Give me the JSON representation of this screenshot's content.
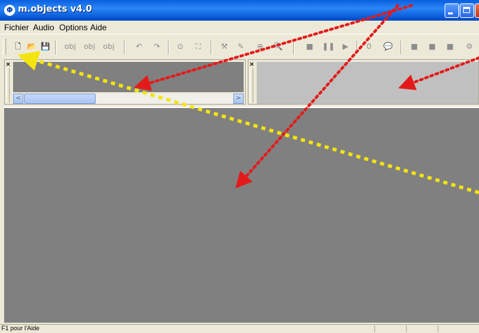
{
  "window": {
    "title": "m.objects v4.0",
    "app_icon_glyph": "Φ"
  },
  "menu": {
    "items": [
      "Fichier",
      "Audio",
      "Options",
      "Aide"
    ]
  },
  "toolbar": {
    "buttons": [
      {
        "name": "new-file-icon",
        "glyph": "🗋",
        "active": true
      },
      {
        "name": "open-folder-icon",
        "glyph": "📂",
        "active": true
      },
      {
        "name": "save-icon",
        "glyph": "💾",
        "active": false
      },
      {
        "name": "add-object-icon",
        "glyph": "obj",
        "active": false
      },
      {
        "name": "object-properties-icon",
        "glyph": "obj",
        "active": false
      },
      {
        "name": "remove-object-icon",
        "glyph": "obj",
        "active": false
      },
      {
        "name": "undo-icon",
        "glyph": "↶",
        "active": false
      },
      {
        "name": "redo-icon",
        "glyph": "↷",
        "active": false
      },
      {
        "name": "cd-icon",
        "glyph": "⊙",
        "active": false
      },
      {
        "name": "screen-icon",
        "glyph": "⛶",
        "active": false
      },
      {
        "name": "tool-icon",
        "glyph": "⚒",
        "active": false
      },
      {
        "name": "pen-icon",
        "glyph": "✎",
        "active": false
      },
      {
        "name": "zoom-in-icon",
        "glyph": "⊕",
        "active": false
      },
      {
        "name": "zoom-icon",
        "glyph": "🔍",
        "active": false
      },
      {
        "name": "stop-icon",
        "glyph": "■",
        "active": false
      },
      {
        "name": "pause-icon",
        "glyph": "❚❚",
        "active": false
      },
      {
        "name": "play-icon",
        "glyph": "▶",
        "active": false
      },
      {
        "name": "counter-icon",
        "glyph": "0",
        "active": false
      },
      {
        "name": "comment-icon",
        "glyph": "💬",
        "active": false
      },
      {
        "name": "block-icon",
        "glyph": "■",
        "active": false
      },
      {
        "name": "block-mark-icon",
        "glyph": "■",
        "active": false
      },
      {
        "name": "block-end-icon",
        "glyph": "■",
        "active": false
      },
      {
        "name": "settings-icon",
        "glyph": "⚙",
        "active": false
      }
    ]
  },
  "panes": {
    "close_glyph": "×"
  },
  "scrollbar": {
    "left_arrow": "<",
    "right_arrow": ">"
  },
  "status": {
    "text": "F1 pour l'Aide"
  },
  "annotation_colors": {
    "red": "#e41a1a",
    "yellow": "#f4e40e"
  }
}
